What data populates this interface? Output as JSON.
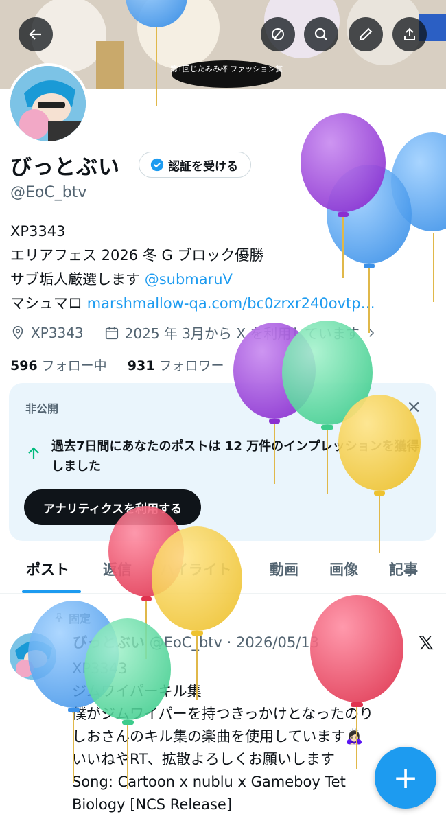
{
  "banner": {
    "caption": "第1回じたみみ杯 ファッション賞"
  },
  "header_buttons": {
    "back": "back-arrow-icon",
    "block": "hide-icon",
    "search": "search-icon",
    "edit": "edit-icon",
    "share": "share-icon"
  },
  "profile": {
    "name": "びっとぶい",
    "verify_label": "認証を受ける",
    "handle": "@EoC_btv",
    "bio": {
      "line1": "XP3343",
      "line2": "エリアフェス 2026 冬 G ブロック優勝",
      "line3_text": "サブ垢人厳選します ",
      "line3_link": "@submaruV",
      "line4_text": "マシュマロ ",
      "line4_link": "marshmallow-qa.com/bc0zrxr240ovtp…"
    },
    "location": "XP3343",
    "joined": "2025 年 3月から X を利用しています",
    "following_count": "596",
    "following_label": "フォロー中",
    "followers_count": "931",
    "followers_label": "フォロワー"
  },
  "card": {
    "label": "非公開",
    "text": "過去7日間にあなたのポストは 12 万件のインプレッションを獲得しました",
    "button": "アナリティクスを利用する",
    "close": "×"
  },
  "tabs": [
    "ポスト",
    "返信",
    "ハイライト",
    "動画",
    "画像",
    "記事"
  ],
  "post": {
    "pinned": "固定",
    "name": "びっとぶい",
    "meta": " @EoC_btv · 2026/05/13",
    "lines": [
      "XP3343",
      "ジムワイパーキル集",
      "僕がジムワイパーを持つきっかけとなったのり",
      "しおさんのキル集の楽曲を使用しています🙇🏻‍♀️",
      "いいねやRT、拡散よろしくお願いします",
      "Song: Cartoon x nublu x Gameboy Tet",
      "Biology [NCS Release]"
    ]
  },
  "fab": {
    "label": "+"
  },
  "colors": {
    "accent": "#1d9bf0",
    "text": "#0f1419",
    "muted": "#536471"
  }
}
